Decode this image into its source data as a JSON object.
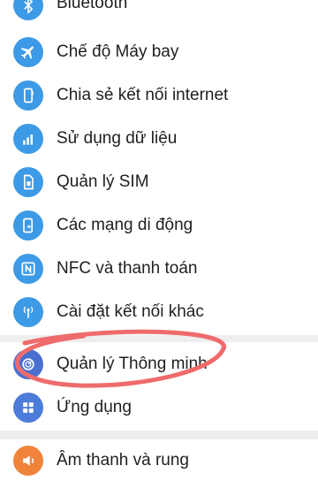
{
  "settings": {
    "items": [
      {
        "label": "Bluetooth",
        "icon": "bluetooth-icon"
      },
      {
        "label": "Chế độ Máy bay",
        "icon": "airplane-icon"
      },
      {
        "label": "Chia sẻ kết nối internet",
        "icon": "hotspot-icon"
      },
      {
        "label": "Sử dụng dữ liệu",
        "icon": "data-usage-icon"
      },
      {
        "label": "Quản lý SIM",
        "icon": "sim-card-icon"
      },
      {
        "label": "Các mạng di động",
        "icon": "mobile-network-icon"
      },
      {
        "label": "NFC và thanh toán",
        "icon": "nfc-icon"
      },
      {
        "label": "Cài đặt kết nối khác",
        "icon": "more-connections-icon"
      },
      {
        "label": "Quản lý Thông minh",
        "icon": "smart-manager-icon"
      },
      {
        "label": "Ứng dụng",
        "icon": "apps-grid-icon"
      },
      {
        "label": "Âm thanh và rung",
        "icon": "sound-icon"
      }
    ]
  },
  "colors": {
    "icon_blue": "#3d9ae6",
    "smart_manager_blue": "#4a6fd1",
    "apps_blue": "#4c7bd9",
    "sound_orange": "#f0833a",
    "annotation_red": "#ef6b6b"
  }
}
